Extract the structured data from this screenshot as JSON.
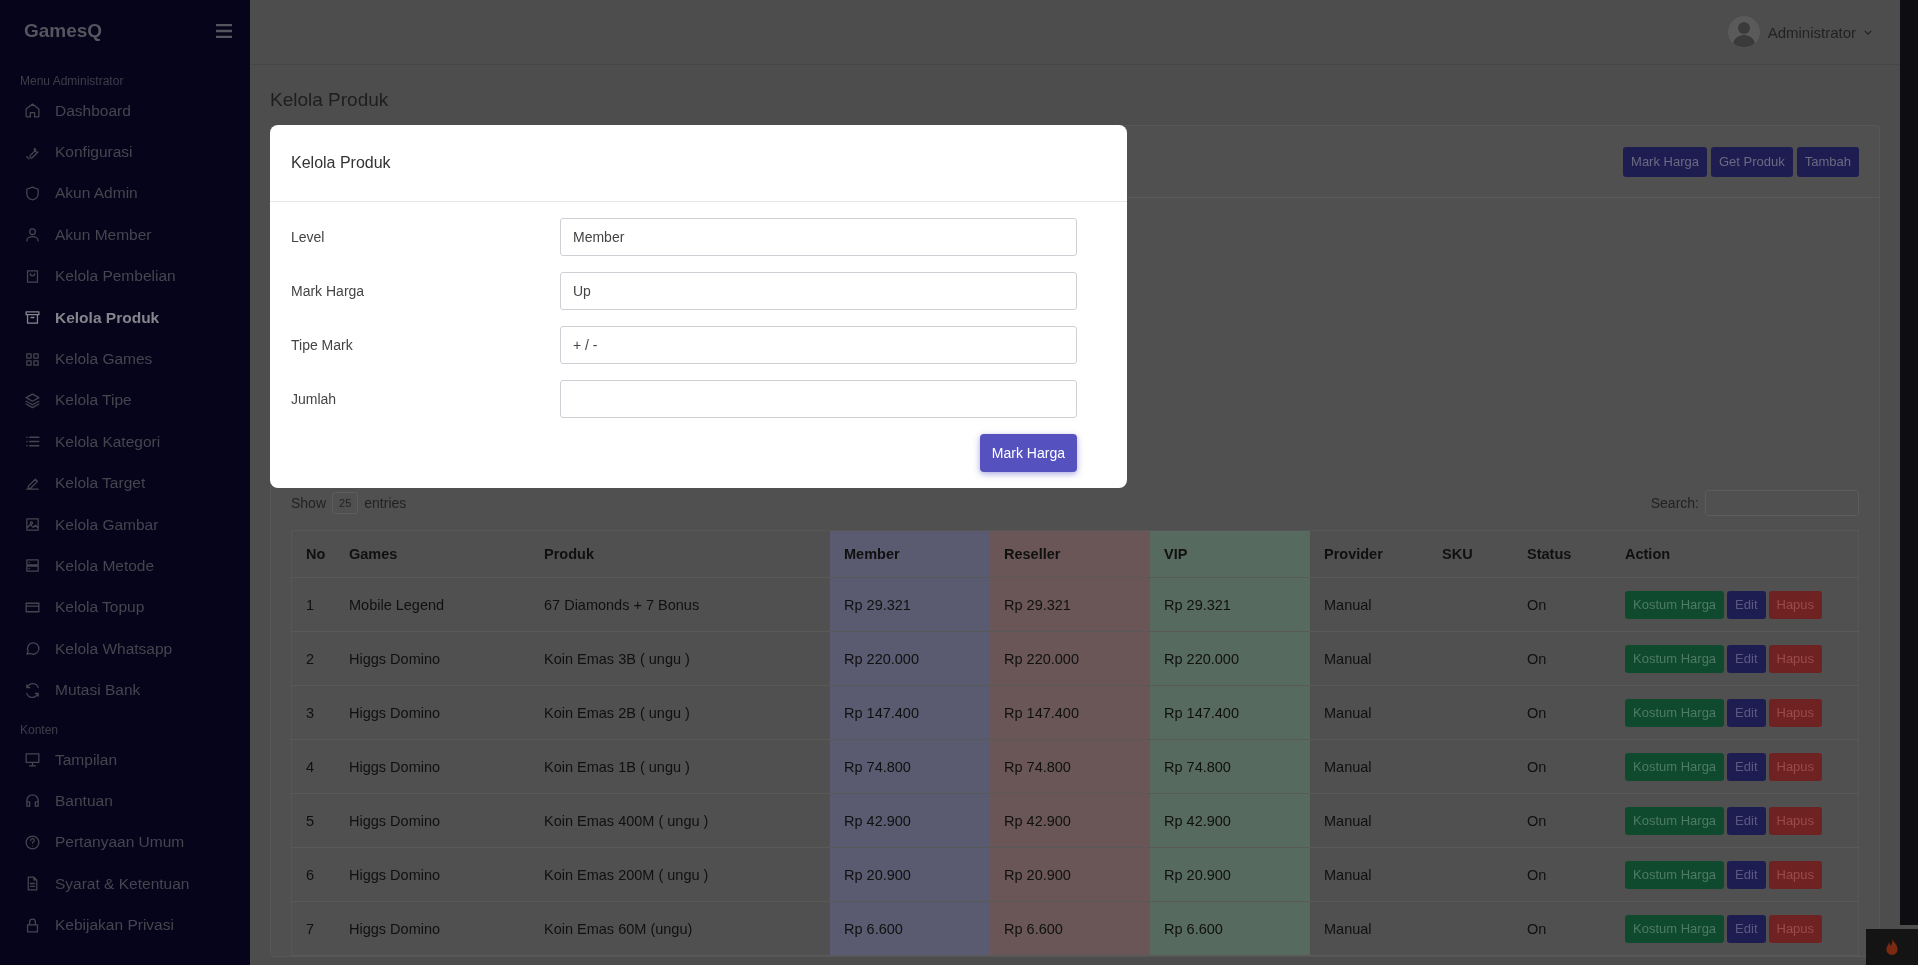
{
  "sidebar": {
    "brand": "GamesQ",
    "sections": [
      {
        "label": "Menu Administrator",
        "items": [
          {
            "label": "Dashboard",
            "selected": false
          },
          {
            "label": "Konfigurasi",
            "selected": false
          },
          {
            "label": "Akun Admin",
            "selected": false
          },
          {
            "label": "Akun Member",
            "selected": false
          },
          {
            "label": "Kelola Pembelian",
            "selected": false
          },
          {
            "label": "Kelola Produk",
            "selected": true
          },
          {
            "label": "Kelola Games",
            "selected": false
          },
          {
            "label": "Kelola Tipe",
            "selected": false
          },
          {
            "label": "Kelola Kategori",
            "selected": false
          },
          {
            "label": "Kelola Target",
            "selected": false
          },
          {
            "label": "Kelola Gambar",
            "selected": false
          },
          {
            "label": "Kelola Metode",
            "selected": false
          },
          {
            "label": "Kelola Topup",
            "selected": false
          },
          {
            "label": "Kelola Whatsapp",
            "selected": false
          },
          {
            "label": "Mutasi Bank",
            "selected": false
          }
        ]
      },
      {
        "label": "Konten",
        "items": [
          {
            "label": "Tampilan",
            "selected": false
          },
          {
            "label": "Bantuan",
            "selected": false
          },
          {
            "label": "Pertanyaan Umum",
            "selected": false
          },
          {
            "label": "Syarat & Ketentuan",
            "selected": false
          },
          {
            "label": "Kebijakan Privasi",
            "selected": false
          }
        ]
      }
    ]
  },
  "header": {
    "user": "Administrator"
  },
  "page_title": "Kelola Produk",
  "card": {
    "buttons": [
      "Mark Harga",
      "Get Produk",
      "Tambah"
    ],
    "show_label": "Show",
    "entries_value": "25",
    "entries_label": "entries",
    "search_label": "Search:",
    "table": {
      "columns": [
        {
          "label": "No"
        },
        {
          "label": "Games"
        },
        {
          "label": "Produk"
        },
        {
          "label": "Member",
          "color": "#5a5a70"
        },
        {
          "label": "Reseller",
          "color": "#6a5656"
        },
        {
          "label": "VIP",
          "color": "#566a5f"
        },
        {
          "label": "Provider"
        },
        {
          "label": "SKU"
        },
        {
          "label": "Status"
        },
        {
          "label": "Action"
        }
      ],
      "rows": [
        {
          "cells": [
            "1",
            "Mobile Legend",
            "67 Diamonds + 7 Bonus",
            "Rp 29.321",
            "Rp 29.321",
            "Rp 29.321",
            "Manual",
            null,
            "On"
          ],
          "actions": [
            {
              "label": "Kostum Harga",
              "kind": "custom"
            },
            {
              "label": "Edit",
              "kind": "edit"
            },
            {
              "label": "Hapus",
              "kind": "delete"
            }
          ]
        },
        {
          "cells": [
            "2",
            "Higgs Domino",
            "Koin Emas 3B ( ungu )",
            "Rp 220.000",
            "Rp 220.000",
            "Rp 220.000",
            "Manual",
            null,
            "On"
          ],
          "actions": [
            {
              "label": "Kostum Harga",
              "kind": "custom"
            },
            {
              "label": "Edit",
              "kind": "edit"
            },
            {
              "label": "Hapus",
              "kind": "delete"
            }
          ]
        },
        {
          "cells": [
            "3",
            "Higgs Domino",
            "Koin Emas 2B ( ungu )",
            "Rp 147.400",
            "Rp 147.400",
            "Rp 147.400",
            "Manual",
            null,
            "On"
          ],
          "actions": [
            {
              "label": "Kostum Harga",
              "kind": "custom"
            },
            {
              "label": "Edit",
              "kind": "edit"
            },
            {
              "label": "Hapus",
              "kind": "delete"
            }
          ]
        },
        {
          "cells": [
            "4",
            "Higgs Domino",
            "Koin Emas 1B ( ungu )",
            "Rp 74.800",
            "Rp 74.800",
            "Rp 74.800",
            "Manual",
            null,
            "On"
          ],
          "actions": [
            {
              "label": "Kostum Harga",
              "kind": "custom"
            },
            {
              "label": "Edit",
              "kind": "edit"
            },
            {
              "label": "Hapus",
              "kind": "delete"
            }
          ]
        },
        {
          "cells": [
            "5",
            "Higgs Domino",
            "Koin Emas 400M ( ungu )",
            "Rp 42.900",
            "Rp 42.900",
            "Rp 42.900",
            "Manual",
            null,
            "On"
          ],
          "actions": [
            {
              "label": "Kostum Harga",
              "kind": "custom"
            },
            {
              "label": "Edit",
              "kind": "edit"
            },
            {
              "label": "Hapus",
              "kind": "delete"
            }
          ]
        },
        {
          "cells": [
            "6",
            "Higgs Domino",
            "Koin Emas 200M ( ungu )",
            "Rp 20.900",
            "Rp 20.900",
            "Rp 20.900",
            "Manual",
            null,
            "On"
          ],
          "actions": [
            {
              "label": "Kostum Harga",
              "kind": "custom"
            },
            {
              "label": "Edit",
              "kind": "edit"
            },
            {
              "label": "Hapus",
              "kind": "delete"
            }
          ]
        },
        {
          "cells": [
            "7",
            "Higgs Domino",
            "Koin Emas 60M (ungu)",
            "Rp 6.600",
            "Rp 6.600",
            "Rp 6.600",
            "Manual",
            null,
            "On"
          ],
          "actions": [
            {
              "label": "Kostum Harga",
              "kind": "custom"
            },
            {
              "label": "Edit",
              "kind": "edit"
            },
            {
              "label": "Hapus",
              "kind": "delete"
            }
          ]
        }
      ]
    }
  },
  "modal": {
    "title": "Kelola Produk",
    "fields": [
      {
        "label": "Level",
        "value": "Member"
      },
      {
        "label": "Mark Harga",
        "value": "Up"
      },
      {
        "label": "Tipe Mark",
        "value": "+ / -"
      },
      {
        "label": "Jumlah"
      }
    ],
    "submit": "Mark Harga"
  }
}
